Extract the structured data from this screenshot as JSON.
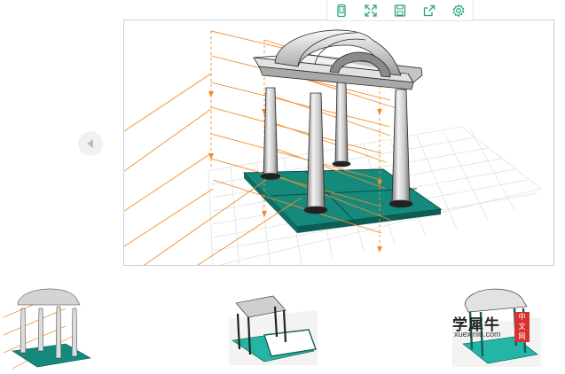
{
  "toolbar": {
    "icons": [
      "phone-icon",
      "fullscreen-icon",
      "save-icon",
      "share-icon",
      "settings-icon"
    ]
  },
  "navigation": {
    "prev_icon": "triangle-left-icon"
  },
  "colors": {
    "accent": "#16a37f",
    "floor": "#0f8074",
    "floor_dark": "#0b5d55",
    "orange_lines": "#f28c28",
    "grid": "#d9d9d9",
    "column": "#d8d8d8"
  },
  "thumbnails": [
    "gazebo-exploded-thumb",
    "gazebo-assembly-thumb",
    "gazebo-final-thumb"
  ],
  "watermark": {
    "brand": "学犀牛",
    "url": "xuexiniu.com",
    "seal": [
      "中",
      "文",
      "网"
    ]
  }
}
